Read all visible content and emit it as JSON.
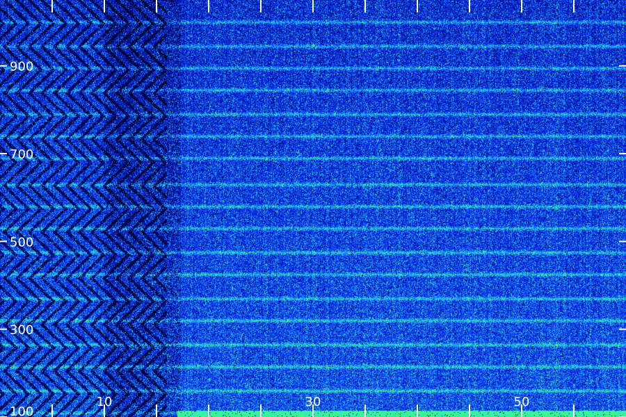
{
  "chart_data": {
    "type": "heatmap",
    "title": "",
    "xlabel": "",
    "ylabel": "",
    "xlim": [
      0,
      60
    ],
    "ylim": [
      100,
      1050
    ],
    "x_tick_labels": [
      {
        "value": 10,
        "label": "10"
      },
      {
        "value": 30,
        "label": "30"
      },
      {
        "value": 50,
        "label": "50"
      }
    ],
    "x_minor_ticks": [
      5,
      15,
      20,
      25,
      35,
      40,
      45,
      55
    ],
    "y_tick_labels": [
      {
        "value": 100,
        "label": "100"
      },
      {
        "value": 300,
        "label": "300"
      },
      {
        "value": 500,
        "label": "500"
      },
      {
        "value": 700,
        "label": "700"
      },
      {
        "value": 900,
        "label": "900"
      }
    ],
    "harmonic_bands_y": [
      110,
      160,
      215,
      265,
      320,
      370,
      425,
      475,
      530,
      580,
      630,
      690,
      740,
      790,
      845,
      895,
      945,
      1000
    ],
    "strong_energy_band_y": [
      100,
      115
    ],
    "strong_energy_band_x": [
      17,
      60
    ],
    "colormap": [
      "#000000",
      "#000a6e",
      "#0a1ed2",
      "#1446ff",
      "#1ea0ff",
      "#28e6dc",
      "#46ff5a"
    ],
    "grid": false
  }
}
